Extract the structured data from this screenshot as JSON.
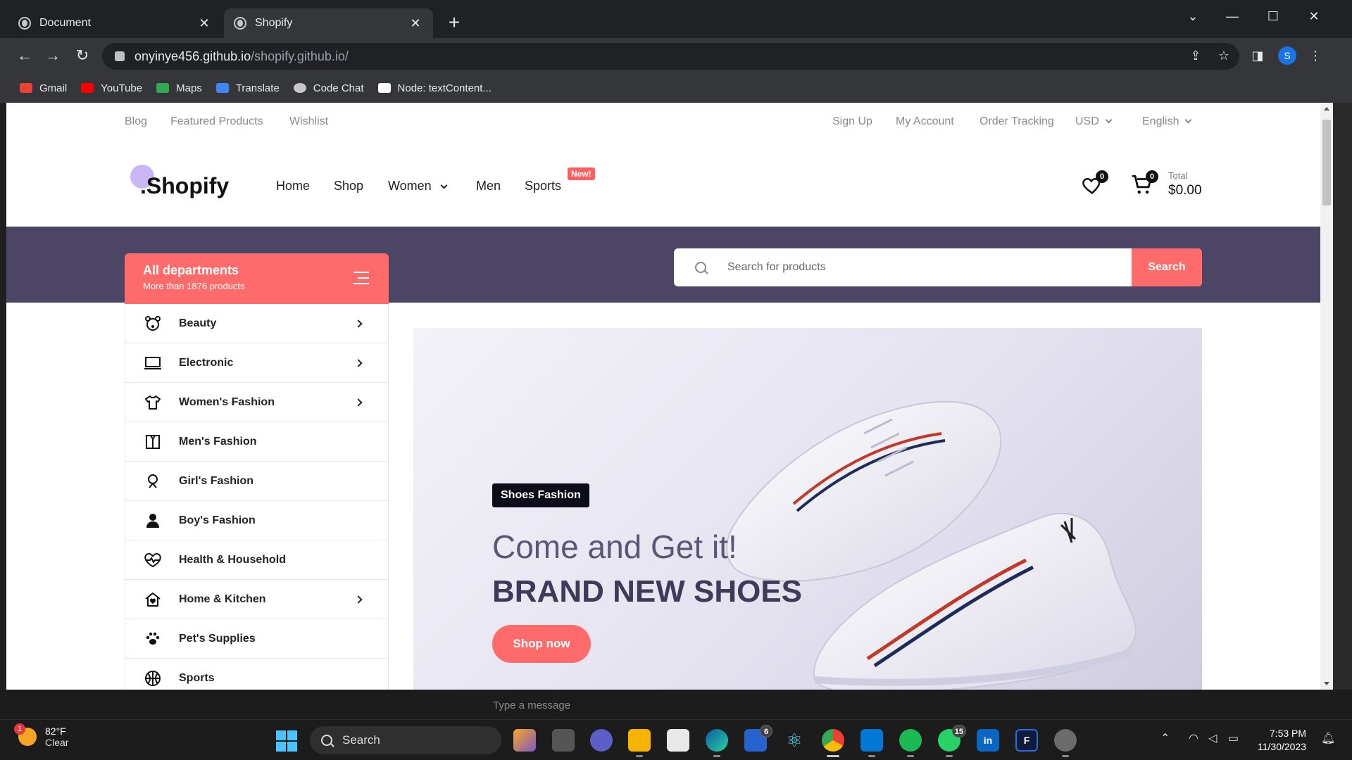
{
  "browser": {
    "tabs": [
      {
        "title": "Document",
        "active": false
      },
      {
        "title": "Shopify",
        "active": true
      }
    ],
    "url_host": "onyinye456.github.io",
    "url_path": "/shopify.github.io/",
    "profile_initial": "S",
    "bookmarks": [
      {
        "label": "Gmail",
        "icon": "gmail-icon",
        "color": "#ea4335"
      },
      {
        "label": "YouTube",
        "icon": "youtube-icon",
        "color": "#ff0000"
      },
      {
        "label": "Maps",
        "icon": "maps-icon",
        "color": "#34a853"
      },
      {
        "label": "Translate",
        "icon": "translate-icon",
        "color": "#4285f4"
      },
      {
        "label": "Code Chat",
        "icon": "code-chat-icon",
        "color": "#c7c7c7"
      },
      {
        "label": "Node: textContent...",
        "icon": "mdn-icon",
        "color": "#ffffff"
      }
    ]
  },
  "page": {
    "topbar_left": [
      "Blog",
      "Featured Products",
      "Wishlist"
    ],
    "topbar_right": [
      "Sign Up",
      "My Account",
      "Order Tracking"
    ],
    "currency": "USD",
    "language": "English",
    "logo": ".Shopify",
    "nav": [
      "Home",
      "Shop",
      "Women",
      "Men",
      "Sports"
    ],
    "new_badge": "New!",
    "wishlist_count": "0",
    "cart_count": "0",
    "total_label": "Total",
    "total_value": "$0.00",
    "departments_title": "All departments",
    "departments_subtitle": "More than 1876 products",
    "search_placeholder": "Search for products",
    "search_button": "Search",
    "departments": [
      {
        "label": "Beauty",
        "icon": "bear-face-icon",
        "has_arrow": true
      },
      {
        "label": "Electronic",
        "icon": "laptop-icon",
        "has_arrow": true
      },
      {
        "label": "Women's Fashion",
        "icon": "shirt-icon",
        "has_arrow": true
      },
      {
        "label": "Men's Fashion",
        "icon": "jacket-icon",
        "has_arrow": false
      },
      {
        "label": "Girl's Fashion",
        "icon": "girl-icon",
        "has_arrow": false
      },
      {
        "label": "Boy's Fashion",
        "icon": "boy-icon",
        "has_arrow": false
      },
      {
        "label": "Health & Household",
        "icon": "heart-pulse-icon",
        "has_arrow": false
      },
      {
        "label": "Home & Kitchen",
        "icon": "house-icon",
        "has_arrow": true
      },
      {
        "label": "Pet's Supplies",
        "icon": "paw-icon",
        "has_arrow": false
      },
      {
        "label": "Sports",
        "icon": "basketball-icon",
        "has_arrow": false
      }
    ],
    "hero": {
      "tag": "Shoes Fashion",
      "headline": "Come and Get it!",
      "subheadline": "BRAND NEW SHOES",
      "cta": "Shop now"
    },
    "accent_color": "#ff6b6b",
    "band_color": "#4d4566"
  },
  "behind": {
    "message_placeholder": "Type a message"
  },
  "taskbar": {
    "weather_temp": "82°F",
    "weather_desc": "Clear",
    "weather_alert": "1",
    "search_label": "Search",
    "badge_todo": "6",
    "badge_whatsapp": "15",
    "time": "7:53 PM",
    "date": "11/30/2023"
  }
}
